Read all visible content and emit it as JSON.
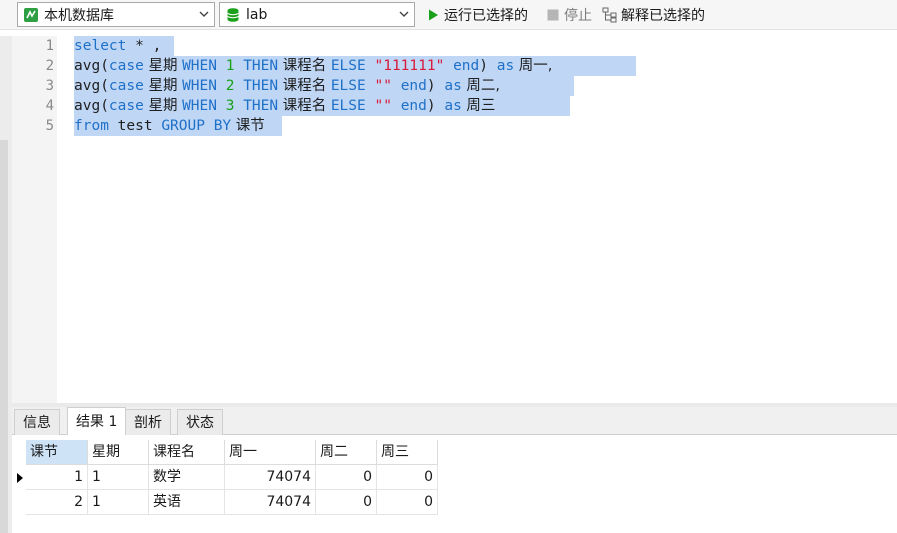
{
  "toolbar": {
    "connection": "本机数据库",
    "database": "lab",
    "run_label": "运行已选择的",
    "stop_label": "停止",
    "explain_label": "解释已选择的",
    "colors": {
      "run": "#1aa01a",
      "db": "#1aa01a",
      "conn": "#2ea043"
    }
  },
  "editor": {
    "line_numbers": [
      "1",
      "2",
      "3",
      "4",
      "5"
    ],
    "lines": [
      [
        "select",
        " * ,"
      ],
      [
        "avg(",
        "case",
        " 星期 ",
        "WHEN",
        " ",
        "1",
        " ",
        "THEN",
        " 课程名 ",
        "ELSE",
        " ",
        "\"111111\"",
        " ",
        "end",
        ") ",
        "as",
        " 周一,"
      ],
      [
        "avg(",
        "case",
        " 星期 ",
        "WHEN",
        " ",
        "2",
        " ",
        "THEN",
        " 课程名 ",
        "ELSE",
        " ",
        "\"\"",
        " ",
        "end",
        ") ",
        "as",
        " 周二,"
      ],
      [
        "avg(",
        "case",
        " 星期 ",
        "WHEN",
        " ",
        "3",
        " ",
        "THEN",
        " 课程名 ",
        "ELSE",
        " ",
        "\"\"",
        " ",
        "end",
        ") ",
        "as",
        " 周三"
      ],
      [
        "from",
        " test ",
        "GROUP BY",
        " 课节"
      ]
    ]
  },
  "tabs": [
    "信息",
    "结果 1",
    "剖析",
    "状态"
  ],
  "results": {
    "columns": [
      "课节",
      "星期",
      "课程名",
      "周一",
      "周二",
      "周三"
    ],
    "rows": [
      [
        "1",
        "1",
        "数学",
        "74074",
        "0",
        "0"
      ],
      [
        "2",
        "1",
        "英语",
        "74074",
        "0",
        "0"
      ]
    ]
  }
}
